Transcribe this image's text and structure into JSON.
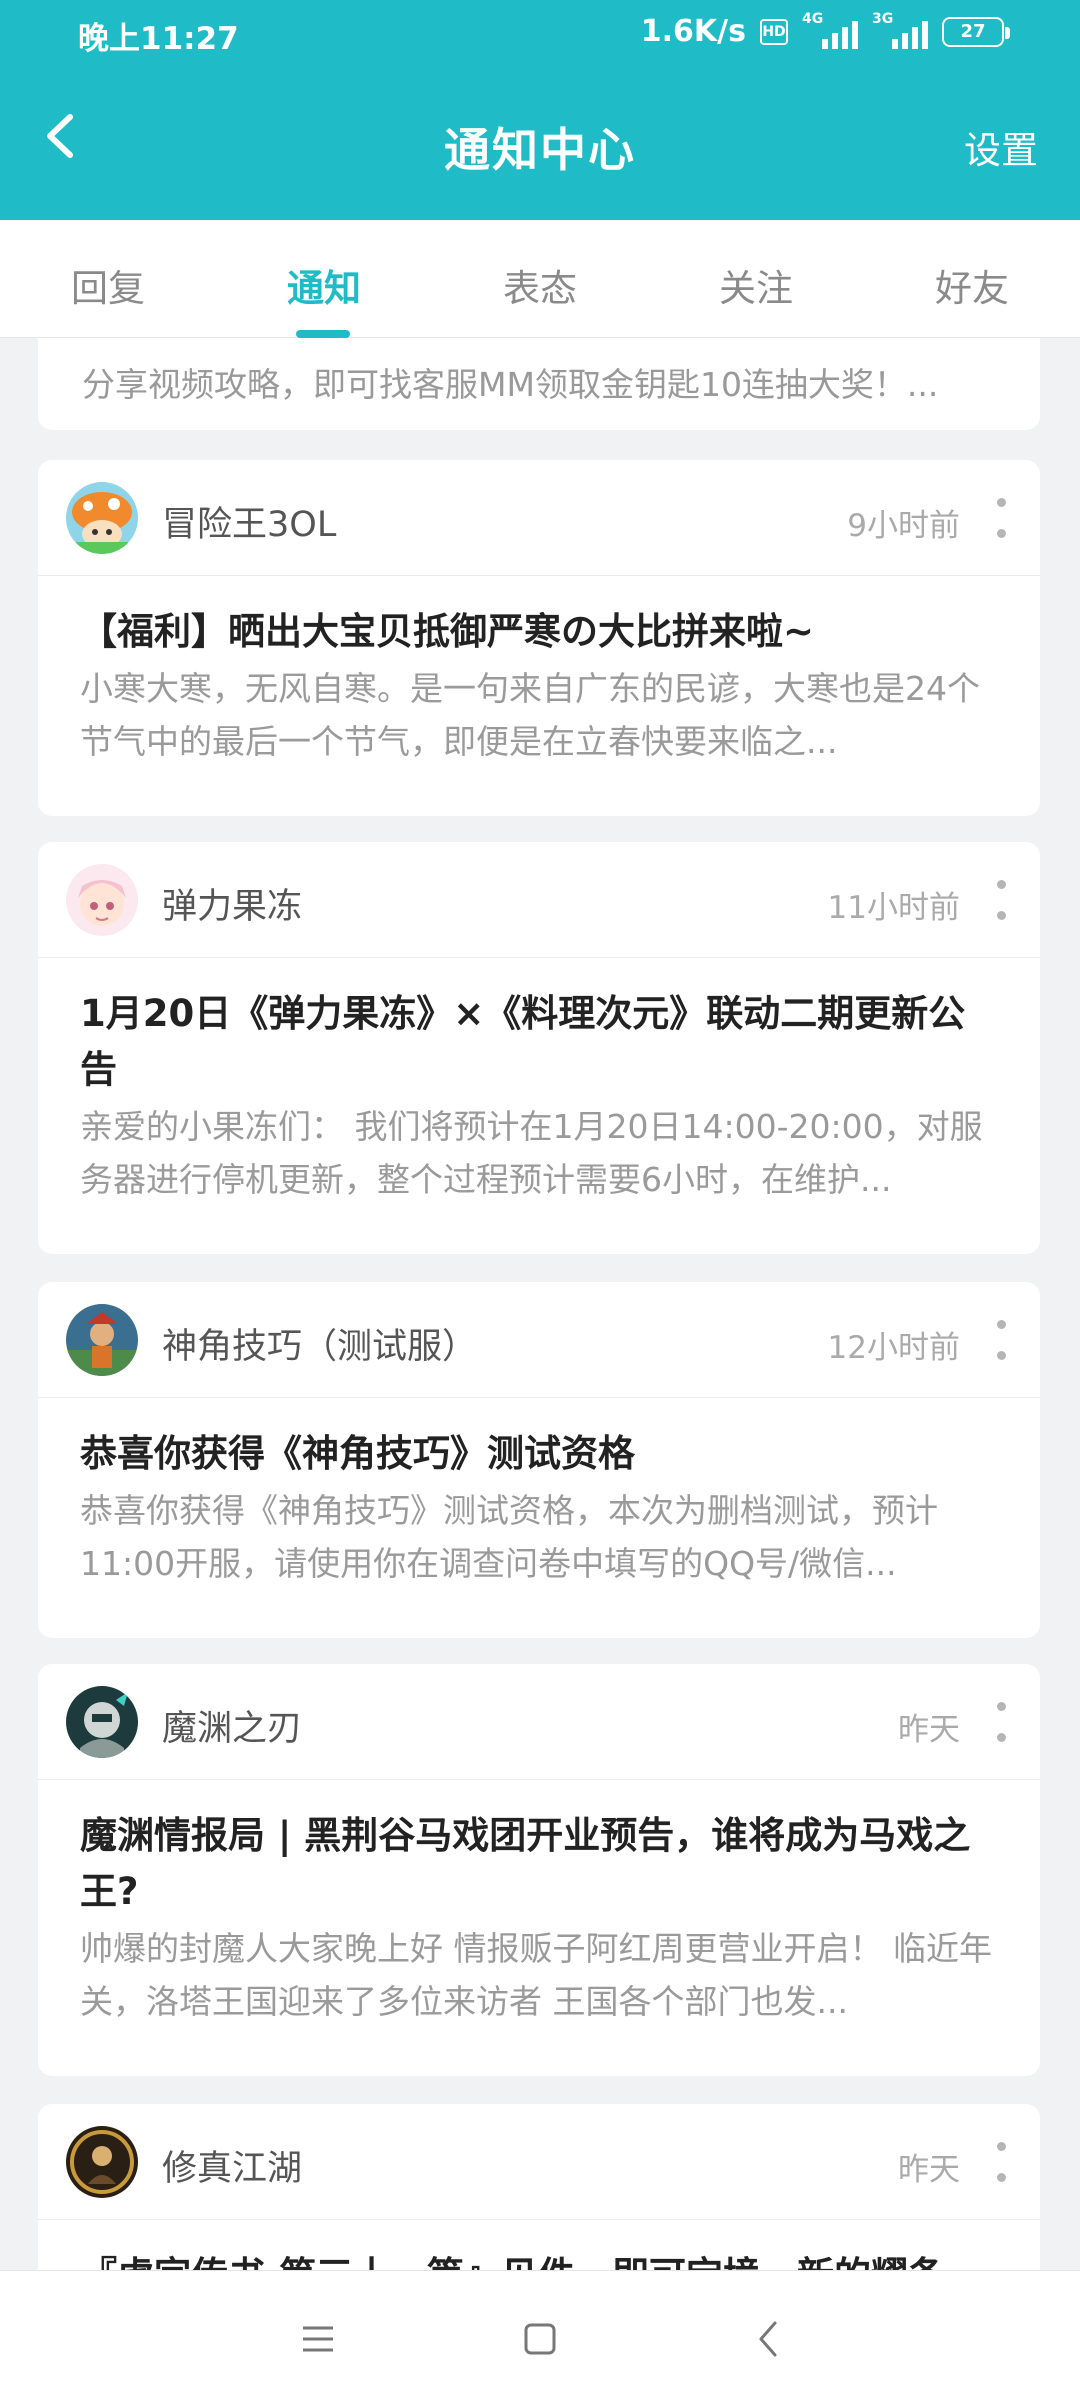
{
  "status_bar": {
    "time": "晚上11:27",
    "net_speed": "1.6K/s",
    "hd": "HD",
    "sim1_tag": "4G",
    "sim2_tag": "3G",
    "battery": "27"
  },
  "header": {
    "title": "通知中心",
    "settings_label": "设置"
  },
  "tabs": [
    {
      "label": "回复",
      "active": false
    },
    {
      "label": "通知",
      "active": true
    },
    {
      "label": "表态",
      "active": false
    },
    {
      "label": "关注",
      "active": false
    },
    {
      "label": "好友",
      "active": false
    }
  ],
  "partial_card": {
    "excerpt": "分享视频攻略，即可找客服MM领取金钥匙10连抽大奖！..."
  },
  "notifications": [
    {
      "source": "冒险王3OL",
      "time": "9小时前",
      "title": "【福利】晒出大宝贝抵御严寒の大比拼来啦~",
      "excerpt": "小寒大寒，无风自寒。是一句来自广东的民谚，大寒也是24个节气中的最后一个节气，即便是在立春快要来临之..."
    },
    {
      "source": "弹力果冻",
      "time": "11小时前",
      "title": "1月20日《弹力果冻》×《料理次元》联动二期更新公告",
      "excerpt": "亲爱的小果冻们： 我们将预计在1月20日14:00-20:00，对服务器进行停机更新，整个过程预计需要6小时，在维护..."
    },
    {
      "source": "神角技巧（测试服）",
      "time": "12小时前",
      "title": "恭喜你获得《神角技巧》测试资格",
      "excerpt": "恭喜你获得《神角技巧》测试资格，本次为删档测试，预计11:00开服，请使用你在调查问卷中填写的QQ号/微信..."
    },
    {
      "source": "魔渊之刃",
      "time": "昨天",
      "title": "魔渊情报局 | 黑荆谷马戏团开业预告，谁将成为马戏之王?",
      "excerpt": "帅爆的封魔人大家晚上好 情报贩子阿红周更营业开启！ 临近年关，洛塔王国迎来了多位来访者 王国各个部门也发..."
    },
    {
      "source": "修真江湖",
      "time": "昨天",
      "title": "『虚宗传书·第三十一篇』见件，即可宝境，新的耀条",
      "excerpt": ""
    }
  ],
  "colors": {
    "accent": "#1fbcc8",
    "background": "#f1f2f4"
  }
}
